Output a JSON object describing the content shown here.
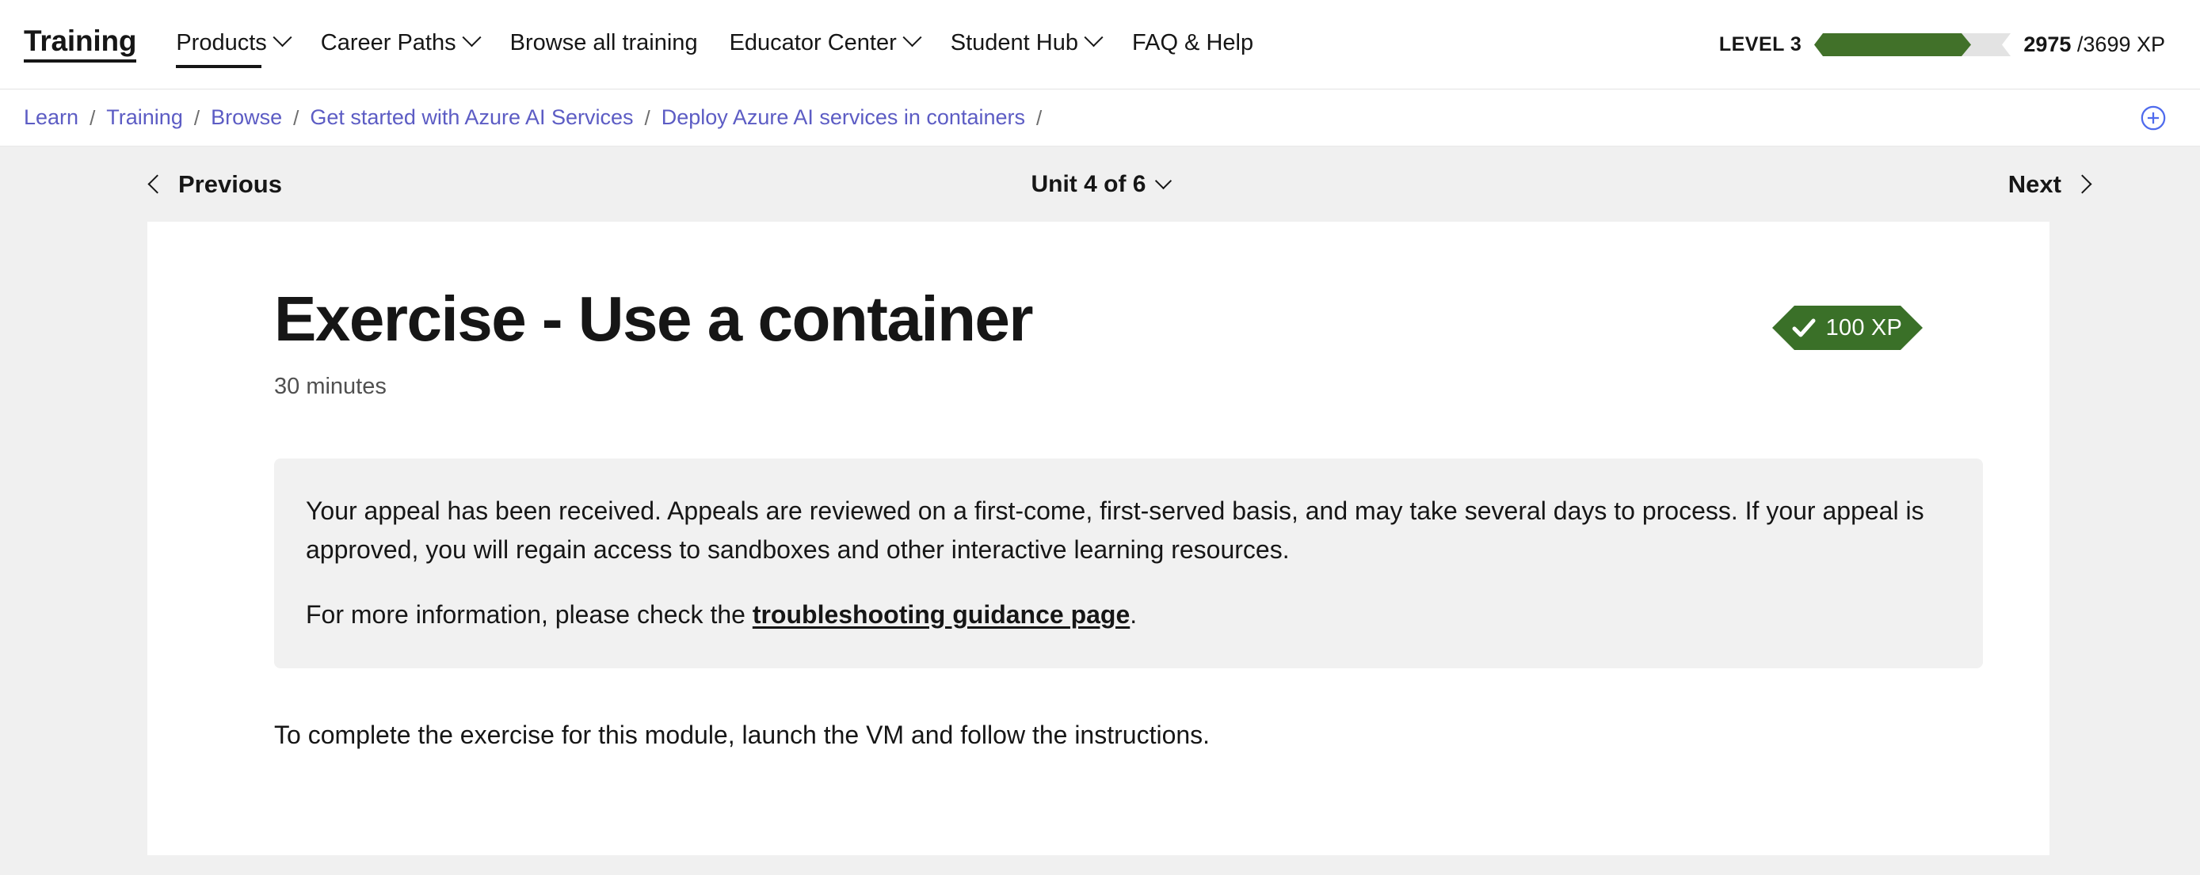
{
  "header": {
    "brand": "Training",
    "nav": [
      {
        "label": "Products",
        "has_chevron": true,
        "underlined": true,
        "icon": "chevron-down-icon"
      },
      {
        "label": "Career Paths",
        "has_chevron": true,
        "underlined": false,
        "icon": "chevron-down-icon"
      },
      {
        "label": "Browse all training",
        "has_chevron": false,
        "underlined": false,
        "icon": ""
      },
      {
        "label": "Educator Center",
        "has_chevron": true,
        "underlined": false,
        "icon": "chevron-down-icon"
      },
      {
        "label": "Student Hub",
        "has_chevron": true,
        "underlined": false,
        "icon": "chevron-down-icon"
      },
      {
        "label": "FAQ & Help",
        "has_chevron": false,
        "underlined": false,
        "icon": ""
      }
    ],
    "xp": {
      "level_label": "LEVEL 3",
      "current_xp": "2975",
      "max_xp": "/3699 XP",
      "progress_percent": 80,
      "fill_color": "#417129",
      "track_color": "#e3e3e3"
    }
  },
  "breadcrumb": {
    "separator": "/",
    "items": [
      {
        "label": "Learn"
      },
      {
        "label": "Training"
      },
      {
        "label": "Browse"
      },
      {
        "label": "Get started with Azure AI Services"
      },
      {
        "label": "Deploy Azure AI services in containers"
      }
    ],
    "trailing_separator": "/",
    "action_icon": "plus-circle-icon",
    "action_icon_color": "#4f6bed"
  },
  "unit_nav": {
    "previous_label": "Previous",
    "previous_icon": "chevron-left-icon",
    "unit_label": "Unit 4 of 6",
    "unit_icon": "chevron-down-icon",
    "next_label": "Next",
    "next_icon": "chevron-right-icon"
  },
  "content": {
    "title": "Exercise - Use a container",
    "duration": "30 minutes",
    "xp_badge": {
      "label": "100 XP",
      "icon": "check-icon",
      "color": "#3a7028"
    },
    "notice": {
      "paragraph_1": "Your appeal has been received. Appeals are reviewed on a first-come, first-served basis, and may take several days to process. If your appeal is approved, you will regain access to sandboxes and other interactive learning resources.",
      "paragraph_2_before": "For more information, please check the ",
      "link_label": "troubleshooting guidance page",
      "paragraph_2_after": "."
    },
    "body_text": "To complete the exercise for this module, launch the VM and follow the instructions."
  }
}
